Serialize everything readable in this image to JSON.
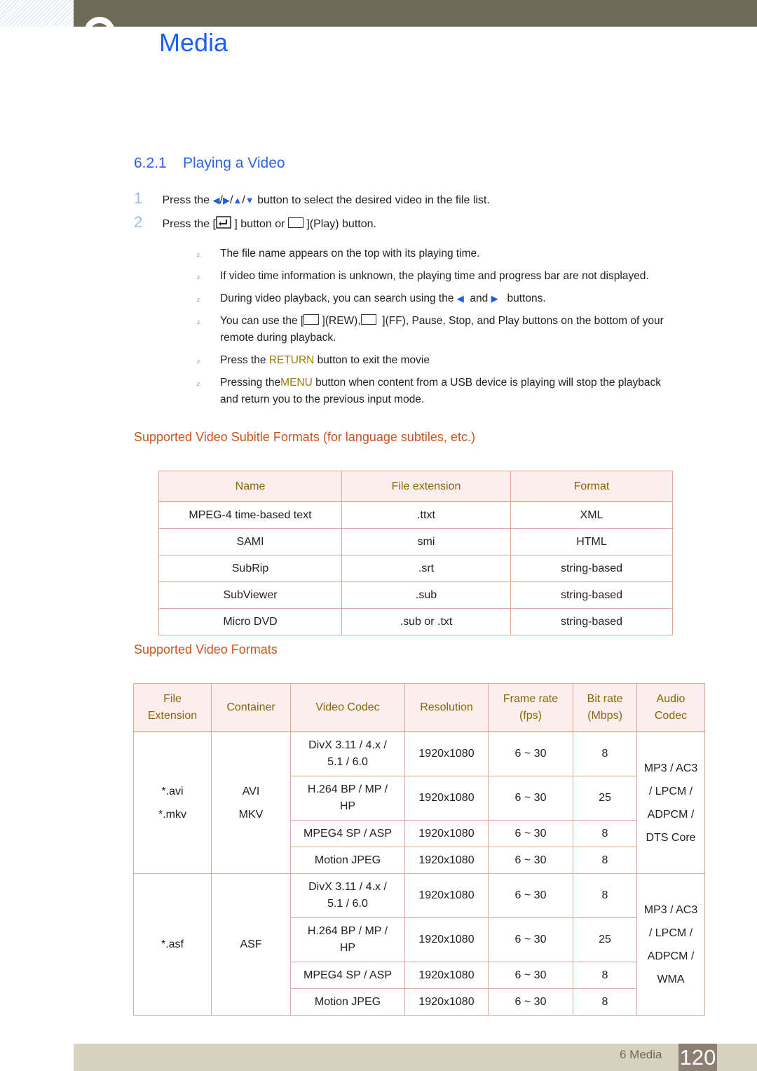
{
  "header": {
    "chapter_title": "Media"
  },
  "section": {
    "number": "6.2.1",
    "title": "Playing a Video"
  },
  "steps": [
    {
      "num": "1",
      "pre": "Press the",
      "arrows": [
        "◀",
        "▶",
        "▲",
        "▼"
      ],
      "post": "button to select the desired video in the file list."
    },
    {
      "num": "2",
      "pre": "Press the [",
      "mid": "] button or",
      "post": "](Play) button."
    }
  ],
  "notes": [
    {
      "text": "The file name appears on the top with its playing time."
    },
    {
      "text": "If video time information is unknown, the playing time and progress bar are not displayed."
    },
    {
      "pre": "During video playback, you can search using the",
      "mid": "and",
      "post": "buttons."
    },
    {
      "pre": "You can use the [",
      "mid1": "](REW),",
      "mid2": "](FF), Pause, Stop, and Play buttons on the bottom of your",
      "line2": "remote during playback."
    },
    {
      "pre": "Press the ",
      "highlight": "RETURN",
      "post": " button to exit the movie"
    },
    {
      "pre": "Pressing the",
      "highlight": "MENU",
      "post": " button when content from a USB device is playing will stop the playback",
      "line2": "and return you to the previous input mode."
    }
  ],
  "subtitle_section": {
    "heading": "Supported Video Subitle Formats (for language subtiles, etc.)",
    "columns": [
      "Name",
      "File extension",
      "Format"
    ],
    "rows": [
      [
        "MPEG-4 time-based text",
        ".ttxt",
        "XML"
      ],
      [
        "SAMI",
        "smi",
        "HTML"
      ],
      [
        "SubRip",
        ".srt",
        "string-based"
      ],
      [
        "SubViewer",
        ".sub",
        "string-based"
      ],
      [
        "Micro DVD",
        ".sub or .txt",
        "string-based"
      ]
    ]
  },
  "video_section": {
    "heading": "Supported Video Formats",
    "columns": [
      {
        "l1": "File",
        "l2": "Extension"
      },
      {
        "l1": "Container",
        "l2": ""
      },
      {
        "l1": "Video Codec",
        "l2": ""
      },
      {
        "l1": "Resolution",
        "l2": ""
      },
      {
        "l1": "Frame rate",
        "l2": "(fps)"
      },
      {
        "l1": "Bit rate",
        "l2": "(Mbps)"
      },
      {
        "l1": "Audio",
        "l2": "Codec"
      }
    ],
    "groups": [
      {
        "extension": [
          "*.avi",
          "*.mkv"
        ],
        "container": [
          "AVI",
          "MKV"
        ],
        "audio": [
          "MP3 / AC3",
          "/ LPCM /",
          "ADPCM /",
          "DTS Core"
        ],
        "rows": [
          {
            "codec": [
              "DivX 3.11 / 4.x /",
              "5.1 / 6.0"
            ],
            "resolution": "1920x1080",
            "fps": "6 ~ 30",
            "bitrate": "8"
          },
          {
            "codec": [
              "H.264 BP / MP /",
              "HP"
            ],
            "resolution": "1920x1080",
            "fps": "6 ~ 30",
            "bitrate": "25"
          },
          {
            "codec": [
              "MPEG4 SP / ASP"
            ],
            "resolution": "1920x1080",
            "fps": "6 ~ 30",
            "bitrate": "8"
          },
          {
            "codec": [
              "Motion JPEG"
            ],
            "resolution": "1920x1080",
            "fps": "6 ~ 30",
            "bitrate": "8"
          }
        ]
      },
      {
        "extension": [
          "*.asf"
        ],
        "container": [
          "ASF"
        ],
        "audio": [
          "MP3 / AC3",
          "/ LPCM /",
          "ADPCM /",
          "WMA"
        ],
        "rows": [
          {
            "codec": [
              "DivX 3.11 / 4.x /",
              "5.1 / 6.0"
            ],
            "resolution": "1920x1080",
            "fps": "6 ~ 30",
            "bitrate": "8"
          },
          {
            "codec": [
              "H.264 BP / MP /",
              "HP"
            ],
            "resolution": "1920x1080",
            "fps": "6 ~ 30",
            "bitrate": "25"
          },
          {
            "codec": [
              "MPEG4 SP / ASP"
            ],
            "resolution": "1920x1080",
            "fps": "6 ~ 30",
            "bitrate": "8"
          },
          {
            "codec": [
              "Motion JPEG"
            ],
            "resolution": "1920x1080",
            "fps": "6 ~ 30",
            "bitrate": "8"
          }
        ]
      }
    ]
  },
  "footer": {
    "label": "6 Media",
    "page": "120"
  },
  "colors": {
    "title_blue": "#1e5ef5",
    "heading_orange": "#c9541e",
    "table_header_text": "#8b6508",
    "table_header_bg": "#fdeeee",
    "top_bar": "#6d6b58",
    "footer_bar": "#d8d3c0",
    "page_badge": "#8a7f72"
  }
}
